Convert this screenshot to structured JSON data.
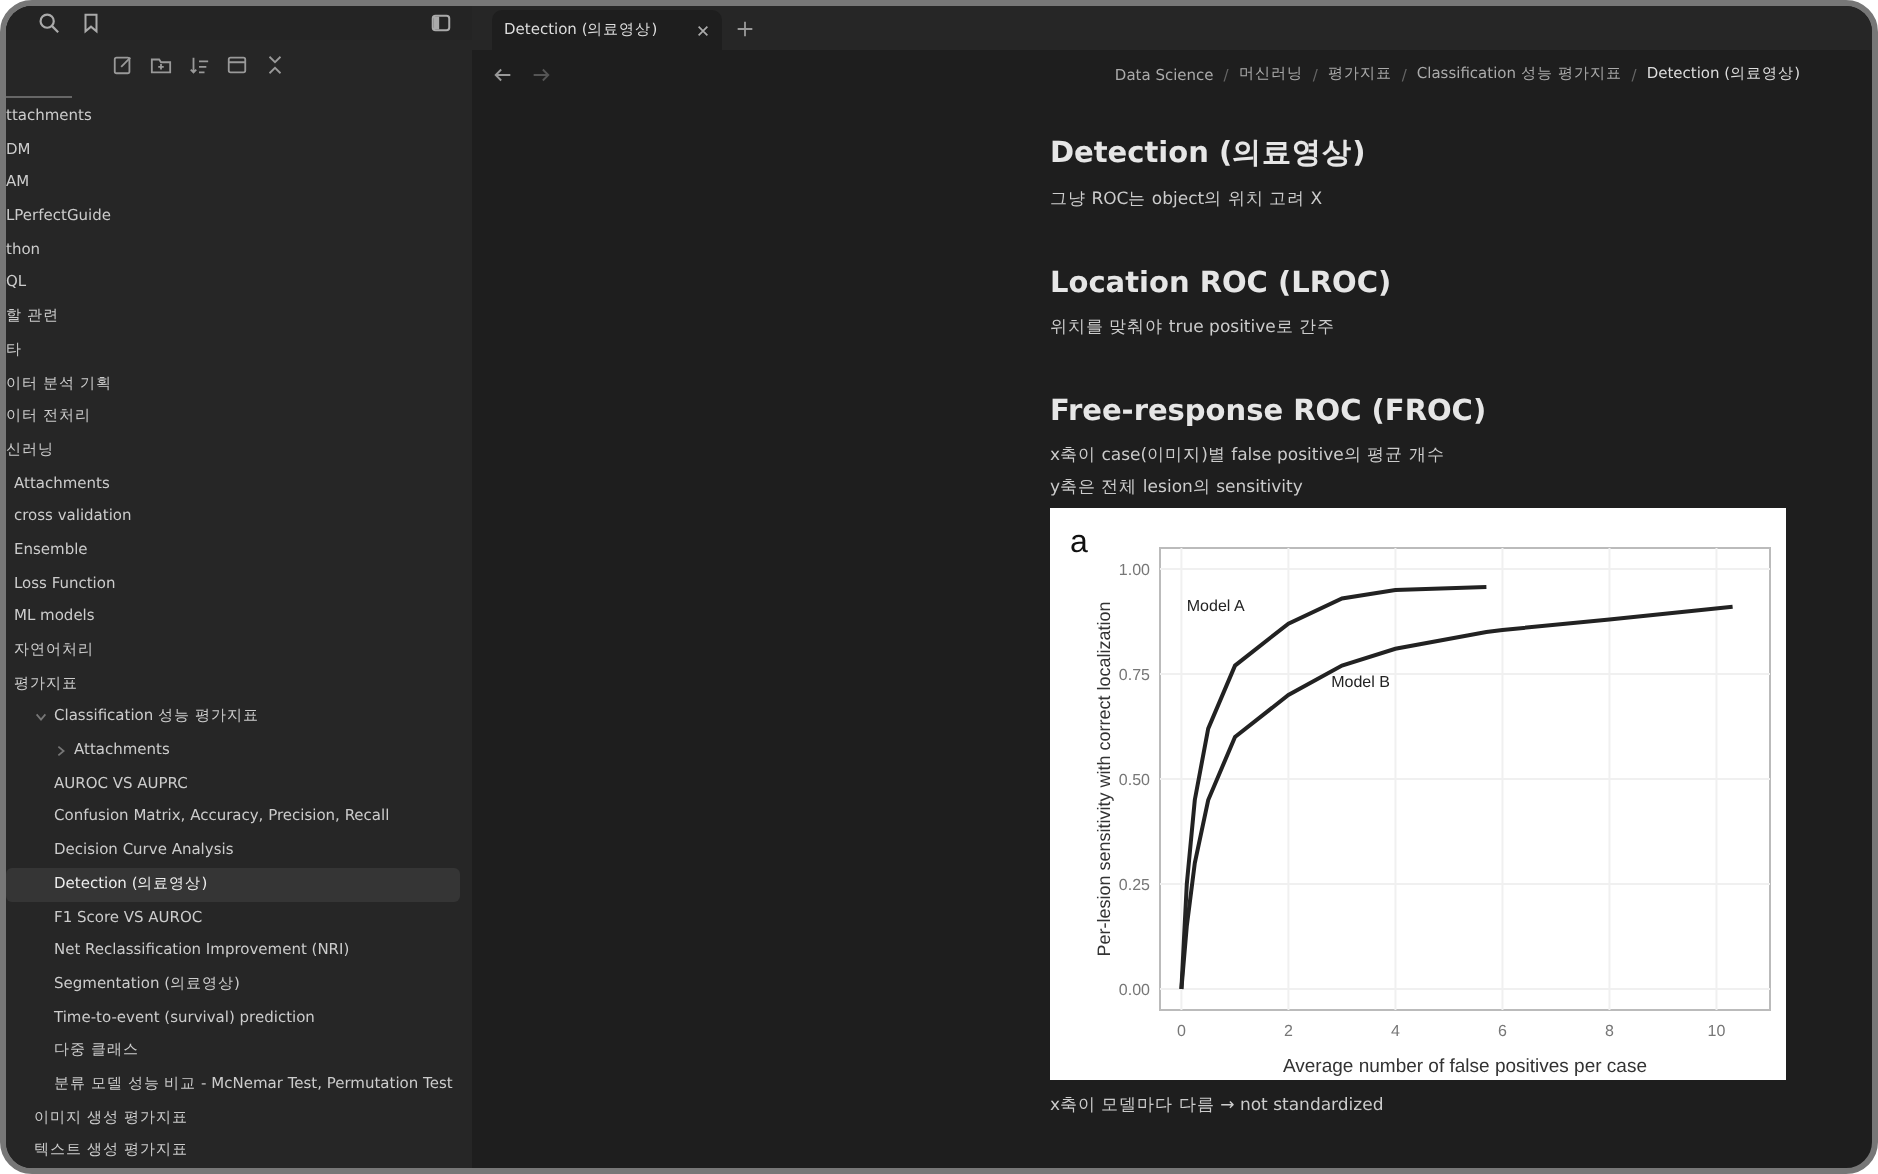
{
  "tabs": [
    {
      "label": "Detection (의료영상)",
      "selected": true
    }
  ],
  "sidebar": {
    "tree": [
      {
        "label": "ttachments",
        "selected": false
      },
      {
        "label": "DM",
        "selected": false
      },
      {
        "label": "AM",
        "selected": false
      },
      {
        "label": "LPerfectGuide",
        "selected": false
      },
      {
        "label": "thon",
        "selected": false
      },
      {
        "label": "QL",
        "selected": false
      },
      {
        "label": "할 관련",
        "selected": false
      },
      {
        "label": "타",
        "selected": false
      },
      {
        "label": "이터 분석 기획",
        "selected": false
      },
      {
        "label": "이터 전처리",
        "selected": false
      },
      {
        "label": "신러닝",
        "selected": false,
        "children": [
          {
            "label": "Attachments",
            "selected": false
          },
          {
            "label": "cross validation",
            "selected": false
          },
          {
            "label": "Ensemble",
            "selected": false
          },
          {
            "label": "Loss Function",
            "selected": false
          },
          {
            "label": "ML models",
            "selected": false
          },
          {
            "label": "자연어처리",
            "selected": false
          },
          {
            "label": "평가지표",
            "selected": false,
            "children": [
              {
                "label": "Classification 성능 평가지표",
                "selected": false,
                "expanded": true,
                "children": [
                  {
                    "label": "Attachments",
                    "selected": false,
                    "expanded": false
                  },
                  {
                    "label": "AUROC VS AUPRC",
                    "selected": false
                  },
                  {
                    "label": "Confusion Matrix, Accuracy, Precision, Recall",
                    "selected": false
                  },
                  {
                    "label": "Decision Curve Analysis",
                    "selected": false
                  },
                  {
                    "label": "Detection (의료영상)",
                    "selected": true
                  },
                  {
                    "label": "F1 Score VS AUROC",
                    "selected": false
                  },
                  {
                    "label": "Net Reclassification Improvement (NRI)",
                    "selected": false
                  },
                  {
                    "label": "Segmentation (의료영상)",
                    "selected": false
                  },
                  {
                    "label": "Time-to-event (survival) prediction",
                    "selected": false
                  },
                  {
                    "label": "다중 클래스",
                    "selected": false
                  },
                  {
                    "label": "분류 모델 성능 비교 - McNemar Test, Permutation Test",
                    "selected": false
                  }
                ]
              },
              {
                "label": "이미지 생성 평가지표",
                "selected": false
              },
              {
                "label": "텍스트 생성 평가지표",
                "selected": false
              }
            ]
          }
        ]
      }
    ]
  },
  "breadcrumb": {
    "separator": "/",
    "items": [
      "Data Science",
      "머신러닝",
      "평가지표",
      "Classification 성능 평가지표",
      "Detection (의료영상)"
    ]
  },
  "note": {
    "sections": [
      {
        "heading": "Detection (의료영상)",
        "lines": [
          "그냥 ROC는 object의 위치 고려 X"
        ]
      },
      {
        "heading": "Location ROC (LROC)",
        "lines": [
          "위치를 맞춰야 true positive로 간주"
        ]
      },
      {
        "heading": "Free-response ROC (FROC)",
        "lines": [
          "x축이 case(이미지)별 false positive의 평균 개수",
          "y축은 전체 lesion의 sensitivity"
        ]
      }
    ],
    "figure": {
      "panel_label": "a",
      "chart_data": {
        "type": "line",
        "xlabel": "Average number of false positives per case",
        "ylabel": "Per-lesion sensitivity with correct localization",
        "x": [
          0,
          0.1,
          0.25,
          0.5,
          1,
          2,
          3,
          4,
          5.7,
          6,
          8,
          10.3
        ],
        "series": [
          {
            "name": "Model A",
            "color": "#222222",
            "values": [
              0,
              0.25,
              0.45,
              0.62,
              0.77,
              0.87,
              0.93,
              0.95,
              0.957,
              null,
              null,
              null
            ]
          },
          {
            "name": "Model B",
            "color": "#222222",
            "values": [
              0,
              0.15,
              0.3,
              0.45,
              0.6,
              0.7,
              0.77,
              0.81,
              0.85,
              0.855,
              0.88,
              0.91
            ]
          }
        ],
        "grid": true,
        "xlim": [
          -0.4,
          11
        ],
        "ylim": [
          -0.05,
          1.05
        ],
        "xticks": [
          0,
          2,
          4,
          6,
          8,
          10
        ],
        "yticks": [
          {
            "value": 0,
            "label": "0.00"
          },
          {
            "value": 0.25,
            "label": "0.25"
          },
          {
            "value": 0.5,
            "label": "0.50"
          },
          {
            "value": 0.75,
            "label": "0.75"
          },
          {
            "value": 1,
            "label": "1.00"
          }
        ]
      }
    },
    "footer": "x축이 모델마다 다름 → not standardized"
  }
}
